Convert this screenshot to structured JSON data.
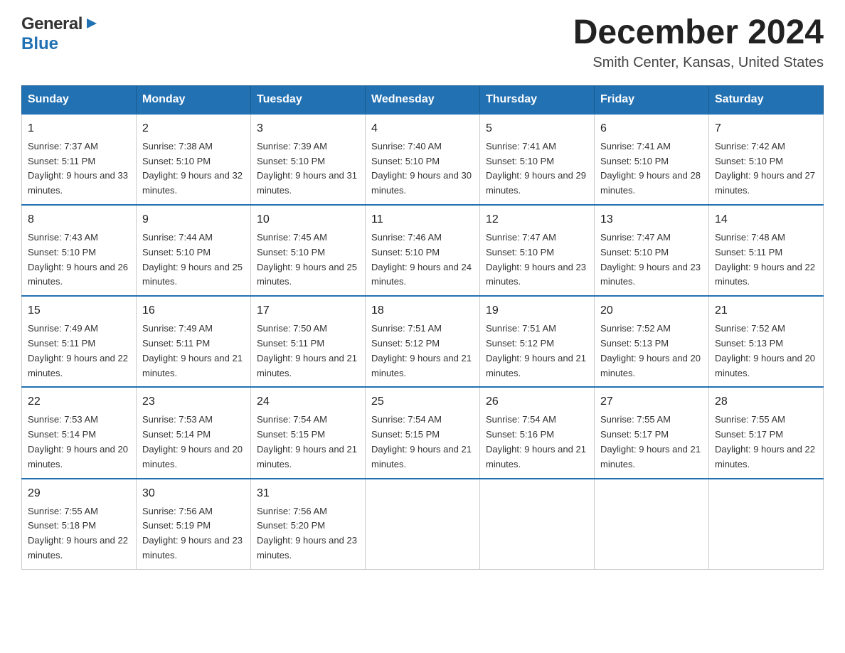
{
  "header": {
    "logo": {
      "general": "General",
      "blue": "Blue",
      "arrow": "▶"
    },
    "title": "December 2024",
    "location": "Smith Center, Kansas, United States"
  },
  "days_of_week": [
    "Sunday",
    "Monday",
    "Tuesday",
    "Wednesday",
    "Thursday",
    "Friday",
    "Saturday"
  ],
  "weeks": [
    [
      {
        "day": "1",
        "sunrise": "Sunrise: 7:37 AM",
        "sunset": "Sunset: 5:11 PM",
        "daylight": "Daylight: 9 hours and 33 minutes."
      },
      {
        "day": "2",
        "sunrise": "Sunrise: 7:38 AM",
        "sunset": "Sunset: 5:10 PM",
        "daylight": "Daylight: 9 hours and 32 minutes."
      },
      {
        "day": "3",
        "sunrise": "Sunrise: 7:39 AM",
        "sunset": "Sunset: 5:10 PM",
        "daylight": "Daylight: 9 hours and 31 minutes."
      },
      {
        "day": "4",
        "sunrise": "Sunrise: 7:40 AM",
        "sunset": "Sunset: 5:10 PM",
        "daylight": "Daylight: 9 hours and 30 minutes."
      },
      {
        "day": "5",
        "sunrise": "Sunrise: 7:41 AM",
        "sunset": "Sunset: 5:10 PM",
        "daylight": "Daylight: 9 hours and 29 minutes."
      },
      {
        "day": "6",
        "sunrise": "Sunrise: 7:41 AM",
        "sunset": "Sunset: 5:10 PM",
        "daylight": "Daylight: 9 hours and 28 minutes."
      },
      {
        "day": "7",
        "sunrise": "Sunrise: 7:42 AM",
        "sunset": "Sunset: 5:10 PM",
        "daylight": "Daylight: 9 hours and 27 minutes."
      }
    ],
    [
      {
        "day": "8",
        "sunrise": "Sunrise: 7:43 AM",
        "sunset": "Sunset: 5:10 PM",
        "daylight": "Daylight: 9 hours and 26 minutes."
      },
      {
        "day": "9",
        "sunrise": "Sunrise: 7:44 AM",
        "sunset": "Sunset: 5:10 PM",
        "daylight": "Daylight: 9 hours and 25 minutes."
      },
      {
        "day": "10",
        "sunrise": "Sunrise: 7:45 AM",
        "sunset": "Sunset: 5:10 PM",
        "daylight": "Daylight: 9 hours and 25 minutes."
      },
      {
        "day": "11",
        "sunrise": "Sunrise: 7:46 AM",
        "sunset": "Sunset: 5:10 PM",
        "daylight": "Daylight: 9 hours and 24 minutes."
      },
      {
        "day": "12",
        "sunrise": "Sunrise: 7:47 AM",
        "sunset": "Sunset: 5:10 PM",
        "daylight": "Daylight: 9 hours and 23 minutes."
      },
      {
        "day": "13",
        "sunrise": "Sunrise: 7:47 AM",
        "sunset": "Sunset: 5:10 PM",
        "daylight": "Daylight: 9 hours and 23 minutes."
      },
      {
        "day": "14",
        "sunrise": "Sunrise: 7:48 AM",
        "sunset": "Sunset: 5:11 PM",
        "daylight": "Daylight: 9 hours and 22 minutes."
      }
    ],
    [
      {
        "day": "15",
        "sunrise": "Sunrise: 7:49 AM",
        "sunset": "Sunset: 5:11 PM",
        "daylight": "Daylight: 9 hours and 22 minutes."
      },
      {
        "day": "16",
        "sunrise": "Sunrise: 7:49 AM",
        "sunset": "Sunset: 5:11 PM",
        "daylight": "Daylight: 9 hours and 21 minutes."
      },
      {
        "day": "17",
        "sunrise": "Sunrise: 7:50 AM",
        "sunset": "Sunset: 5:11 PM",
        "daylight": "Daylight: 9 hours and 21 minutes."
      },
      {
        "day": "18",
        "sunrise": "Sunrise: 7:51 AM",
        "sunset": "Sunset: 5:12 PM",
        "daylight": "Daylight: 9 hours and 21 minutes."
      },
      {
        "day": "19",
        "sunrise": "Sunrise: 7:51 AM",
        "sunset": "Sunset: 5:12 PM",
        "daylight": "Daylight: 9 hours and 21 minutes."
      },
      {
        "day": "20",
        "sunrise": "Sunrise: 7:52 AM",
        "sunset": "Sunset: 5:13 PM",
        "daylight": "Daylight: 9 hours and 20 minutes."
      },
      {
        "day": "21",
        "sunrise": "Sunrise: 7:52 AM",
        "sunset": "Sunset: 5:13 PM",
        "daylight": "Daylight: 9 hours and 20 minutes."
      }
    ],
    [
      {
        "day": "22",
        "sunrise": "Sunrise: 7:53 AM",
        "sunset": "Sunset: 5:14 PM",
        "daylight": "Daylight: 9 hours and 20 minutes."
      },
      {
        "day": "23",
        "sunrise": "Sunrise: 7:53 AM",
        "sunset": "Sunset: 5:14 PM",
        "daylight": "Daylight: 9 hours and 20 minutes."
      },
      {
        "day": "24",
        "sunrise": "Sunrise: 7:54 AM",
        "sunset": "Sunset: 5:15 PM",
        "daylight": "Daylight: 9 hours and 21 minutes."
      },
      {
        "day": "25",
        "sunrise": "Sunrise: 7:54 AM",
        "sunset": "Sunset: 5:15 PM",
        "daylight": "Daylight: 9 hours and 21 minutes."
      },
      {
        "day": "26",
        "sunrise": "Sunrise: 7:54 AM",
        "sunset": "Sunset: 5:16 PM",
        "daylight": "Daylight: 9 hours and 21 minutes."
      },
      {
        "day": "27",
        "sunrise": "Sunrise: 7:55 AM",
        "sunset": "Sunset: 5:17 PM",
        "daylight": "Daylight: 9 hours and 21 minutes."
      },
      {
        "day": "28",
        "sunrise": "Sunrise: 7:55 AM",
        "sunset": "Sunset: 5:17 PM",
        "daylight": "Daylight: 9 hours and 22 minutes."
      }
    ],
    [
      {
        "day": "29",
        "sunrise": "Sunrise: 7:55 AM",
        "sunset": "Sunset: 5:18 PM",
        "daylight": "Daylight: 9 hours and 22 minutes."
      },
      {
        "day": "30",
        "sunrise": "Sunrise: 7:56 AM",
        "sunset": "Sunset: 5:19 PM",
        "daylight": "Daylight: 9 hours and 23 minutes."
      },
      {
        "day": "31",
        "sunrise": "Sunrise: 7:56 AM",
        "sunset": "Sunset: 5:20 PM",
        "daylight": "Daylight: 9 hours and 23 minutes."
      },
      null,
      null,
      null,
      null
    ]
  ]
}
